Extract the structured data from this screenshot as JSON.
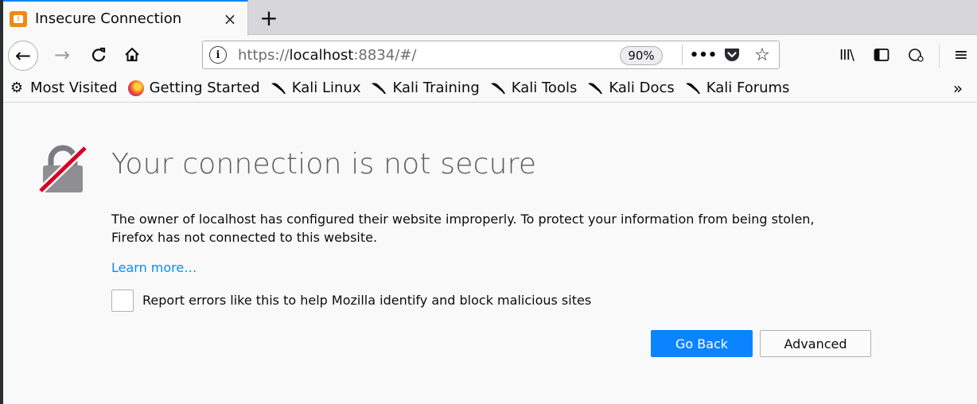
{
  "tab": {
    "title": "Insecure Connection",
    "close": "×",
    "new_tab": "+"
  },
  "nav": {
    "back": "←",
    "forward": "→",
    "reload": "⟳",
    "home": "⌂",
    "url_prefix": "https://",
    "url_host": "localhost",
    "url_suffix": ":8834/#/",
    "zoom": "90%",
    "page_actions": "•••",
    "star": "☆",
    "library": "III\\",
    "menu": "≡"
  },
  "bookmarks": {
    "items": [
      {
        "label": "Most Visited",
        "icon": "gear-icon"
      },
      {
        "label": "Getting Started",
        "icon": "firefox-icon"
      },
      {
        "label": "Kali Linux",
        "icon": "kali-dragon-icon"
      },
      {
        "label": "Kali Training",
        "icon": "kali-dragon-icon"
      },
      {
        "label": "Kali Tools",
        "icon": "kali-dragon-icon"
      },
      {
        "label": "Kali Docs",
        "icon": "kali-dragon-icon"
      },
      {
        "label": "Kali Forums",
        "icon": "kali-dragon-icon"
      }
    ],
    "overflow": "»"
  },
  "error": {
    "title": "Your connection is not secure",
    "description_line1": "The owner of localhost has configured their website improperly. To protect your information from being stolen,",
    "description_line2": "Firefox has not connected to this website.",
    "learn_more": "Learn more…",
    "report_label": "Report errors like this to help Mozilla identify and block malicious sites",
    "report_checked": false,
    "go_back": "Go Back",
    "advanced": "Advanced"
  },
  "colors": {
    "accent": "#0a84ff",
    "warning": "#ef8a17",
    "slash": "#d70022"
  }
}
